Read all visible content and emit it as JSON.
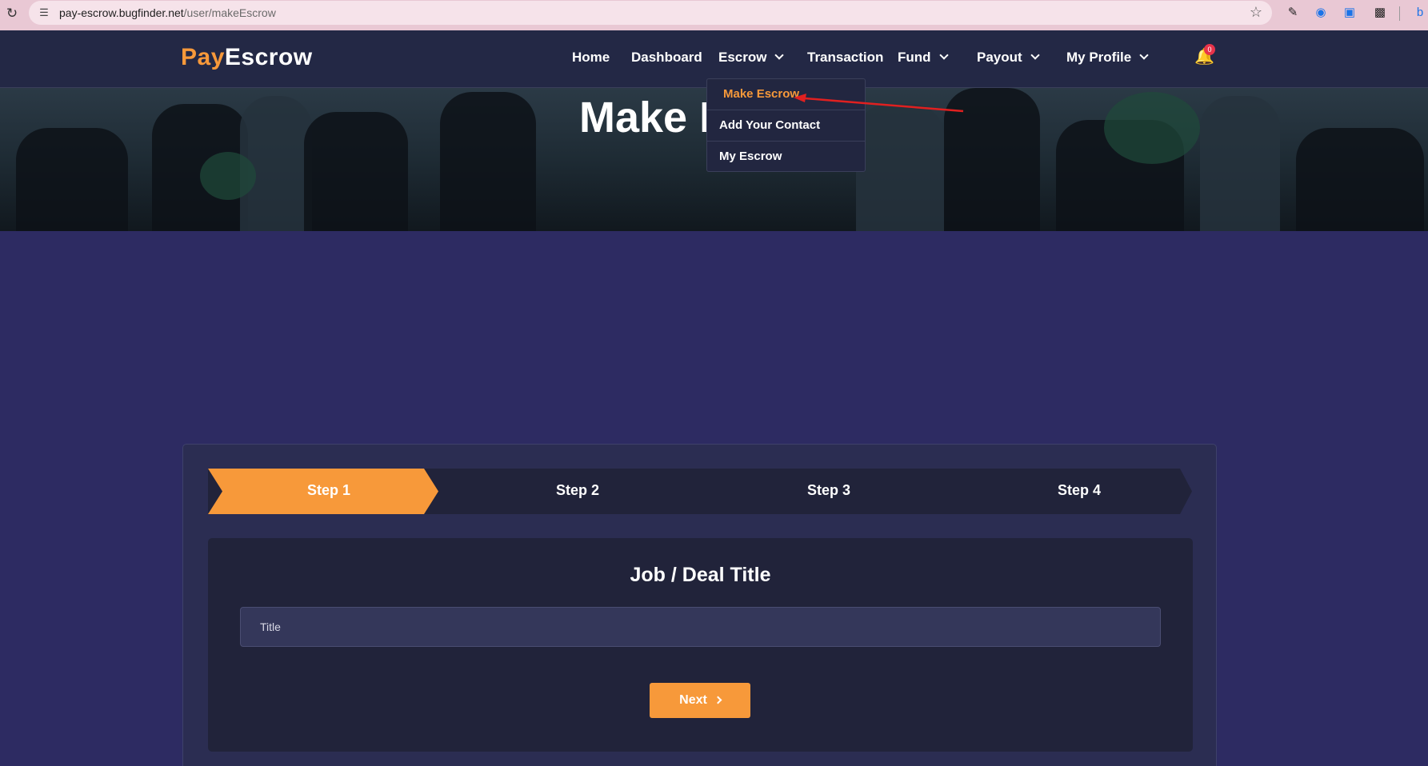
{
  "browser": {
    "url_host": "pay-escrow.bugfinder.net",
    "url_path": "/user/makeEscrow"
  },
  "brand": {
    "part1": "Pay",
    "part2": "Escrow",
    "accent_color": "#f7993a"
  },
  "nav": {
    "home": "Home",
    "dashboard": "Dashboard",
    "escrow": "Escrow",
    "transaction": "Transaction",
    "fund": "Fund",
    "payout": "Payout",
    "my_profile": "My Profile",
    "notification_count": "0"
  },
  "banner": {
    "title": "Make E"
  },
  "dropdown": {
    "items": [
      "Make Escrow",
      "Add Your Contact",
      "My Escrow"
    ],
    "active_index": 0
  },
  "steps": [
    "Step 1",
    "Step 2",
    "Step 3",
    "Step 4"
  ],
  "form": {
    "heading": "Job / Deal Title",
    "title_placeholder": "Title",
    "title_value": "",
    "next_label": "Next"
  },
  "colors": {
    "background": "#2d2b62",
    "navbar": "#232845",
    "step_active": "#f7993a",
    "step_inactive": "#21233a"
  }
}
